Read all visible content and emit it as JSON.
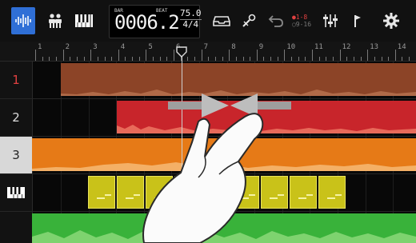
{
  "toolbar": {
    "icons": [
      "waveform-icon",
      "mixer-people-icon",
      "piano-keys-icon",
      "mailbox-icon",
      "record-arm-icon",
      "undo-icon",
      "input-routing-icon",
      "mixer-faders-icon",
      "flag-icon",
      "gear-icon"
    ],
    "counter": {
      "bar_label": "BAR",
      "beat_label": "BEAT",
      "position": "0006.2",
      "tempo": "75.0",
      "time_signature": "4/4"
    },
    "input_routing": {
      "top": "1-8",
      "bottom": "9-16"
    }
  },
  "ruler": {
    "numbers": [
      "1",
      "2",
      "3",
      "4",
      "5",
      "6",
      "7",
      "8",
      "9",
      "10",
      "11",
      "12",
      "13",
      "14"
    ]
  },
  "tracks": [
    {
      "label": "1",
      "color": "#9b4a2a"
    },
    {
      "label": "2",
      "color": "#c8252b"
    },
    {
      "label": "3",
      "color": "#e67a17"
    },
    {
      "label": "",
      "icon": "piano-keys-icon",
      "color": "#c9c219"
    },
    {
      "label": "",
      "color": "#39b23a"
    }
  ],
  "gesture": {
    "type": "pinch-in",
    "arrows": [
      "arrow-right-icon",
      "arrow-left-icon"
    ]
  },
  "colors": {
    "accent": "#2f6fd6",
    "background": "#080808"
  }
}
